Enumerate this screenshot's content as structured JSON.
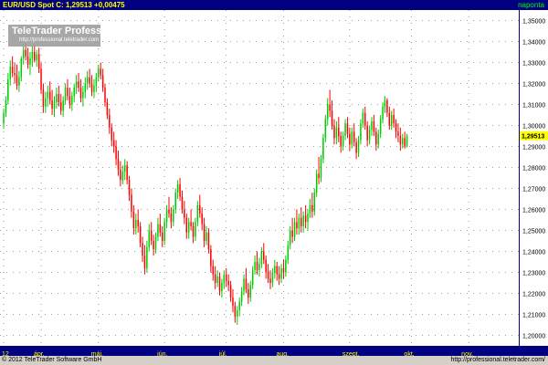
{
  "header": {
    "left_text": "EUR/USD Spot C: 1,29513 +0,00475",
    "right_text": "naponta"
  },
  "watermark": {
    "title": "TeleTrader Professional",
    "url": "http://professional.teletrader.com"
  },
  "footer": {
    "left": "© 2012 TeleTrader Software GmbH",
    "right": "http://professional.teletrader.com/"
  },
  "colors": {
    "up": "#00cc00",
    "down": "#ff0000",
    "grid": "#808080",
    "axis_bg": "#000080",
    "axis_text": "#ffff00",
    "last_price_bg": "#ffff00"
  },
  "chart_data": {
    "type": "candlestick",
    "symbol": "EUR/USD Spot",
    "frequency": "naponta",
    "last_close": 1.29513,
    "last_close_label": "1,29513",
    "change": 0.00475,
    "ylim": [
      1.195,
      1.355
    ],
    "yticks": [
      1.2,
      1.21,
      1.22,
      1.23,
      1.24,
      1.25,
      1.26,
      1.27,
      1.28,
      1.29,
      1.3,
      1.31,
      1.32,
      1.33,
      1.34,
      1.35
    ],
    "ytick_labels": [
      "1,20000",
      "1,21000",
      "1,22000",
      "1,23000",
      "1,24000",
      "1,25000",
      "1,26000",
      "1,27000",
      "1,28000",
      "1,29000",
      "1,30000",
      "1,31000",
      "1,32000",
      "1,33000",
      "1,34000",
      "1,35000"
    ],
    "xlim": [
      0,
      213
    ],
    "xticks": [
      {
        "label": "12",
        "x": 0
      },
      {
        "label": "ápr.",
        "x": 17
      },
      {
        "label": "máj.",
        "x": 43
      },
      {
        "label": "jún.",
        "x": 73
      },
      {
        "label": "júl.",
        "x": 101
      },
      {
        "label": "aug.",
        "x": 127
      },
      {
        "label": "szept.",
        "x": 157
      },
      {
        "label": "okt.",
        "x": 185
      },
      {
        "label": "nov.",
        "x": 211
      }
    ],
    "grid": true,
    "candles": [
      {
        "o": 1.301,
        "h": 1.308,
        "l": 1.2985,
        "c": 1.306
      },
      {
        "o": 1.306,
        "h": 1.314,
        "l": 1.304,
        "c": 1.312
      },
      {
        "o": 1.312,
        "h": 1.325,
        "l": 1.31,
        "c": 1.322
      },
      {
        "o": 1.322,
        "h": 1.331,
        "l": 1.319,
        "c": 1.328
      },
      {
        "o": 1.328,
        "h": 1.333,
        "l": 1.323,
        "c": 1.325
      },
      {
        "o": 1.325,
        "h": 1.33,
        "l": 1.32,
        "c": 1.324
      },
      {
        "o": 1.324,
        "h": 1.329,
        "l": 1.317,
        "c": 1.319
      },
      {
        "o": 1.319,
        "h": 1.326,
        "l": 1.316,
        "c": 1.323
      },
      {
        "o": 1.323,
        "h": 1.333,
        "l": 1.321,
        "c": 1.332
      },
      {
        "o": 1.332,
        "h": 1.339,
        "l": 1.329,
        "c": 1.336
      },
      {
        "o": 1.336,
        "h": 1.34,
        "l": 1.331,
        "c": 1.333
      },
      {
        "o": 1.333,
        "h": 1.337,
        "l": 1.327,
        "c": 1.329
      },
      {
        "o": 1.329,
        "h": 1.335,
        "l": 1.324,
        "c": 1.332
      },
      {
        "o": 1.332,
        "h": 1.338,
        "l": 1.328,
        "c": 1.335
      },
      {
        "o": 1.335,
        "h": 1.339,
        "l": 1.33,
        "c": 1.331
      },
      {
        "o": 1.331,
        "h": 1.336,
        "l": 1.328,
        "c": 1.334
      },
      {
        "o": 1.334,
        "h": 1.337,
        "l": 1.325,
        "c": 1.327
      },
      {
        "o": 1.327,
        "h": 1.33,
        "l": 1.315,
        "c": 1.317
      },
      {
        "o": 1.317,
        "h": 1.32,
        "l": 1.306,
        "c": 1.309
      },
      {
        "o": 1.309,
        "h": 1.316,
        "l": 1.306,
        "c": 1.313
      },
      {
        "o": 1.313,
        "h": 1.319,
        "l": 1.309,
        "c": 1.316
      },
      {
        "o": 1.316,
        "h": 1.321,
        "l": 1.31,
        "c": 1.312
      },
      {
        "o": 1.312,
        "h": 1.317,
        "l": 1.305,
        "c": 1.308
      },
      {
        "o": 1.308,
        "h": 1.314,
        "l": 1.304,
        "c": 1.311
      },
      {
        "o": 1.311,
        "h": 1.318,
        "l": 1.308,
        "c": 1.315
      },
      {
        "o": 1.315,
        "h": 1.319,
        "l": 1.309,
        "c": 1.311
      },
      {
        "o": 1.311,
        "h": 1.315,
        "l": 1.305,
        "c": 1.307
      },
      {
        "o": 1.307,
        "h": 1.314,
        "l": 1.304,
        "c": 1.312
      },
      {
        "o": 1.312,
        "h": 1.32,
        "l": 1.31,
        "c": 1.318
      },
      {
        "o": 1.318,
        "h": 1.322,
        "l": 1.312,
        "c": 1.314
      },
      {
        "o": 1.314,
        "h": 1.318,
        "l": 1.308,
        "c": 1.31
      },
      {
        "o": 1.31,
        "h": 1.316,
        "l": 1.307,
        "c": 1.314
      },
      {
        "o": 1.314,
        "h": 1.32,
        "l": 1.311,
        "c": 1.318
      },
      {
        "o": 1.318,
        "h": 1.324,
        "l": 1.315,
        "c": 1.321
      },
      {
        "o": 1.321,
        "h": 1.325,
        "l": 1.316,
        "c": 1.318
      },
      {
        "o": 1.318,
        "h": 1.322,
        "l": 1.311,
        "c": 1.313
      },
      {
        "o": 1.313,
        "h": 1.319,
        "l": 1.309,
        "c": 1.316
      },
      {
        "o": 1.316,
        "h": 1.323,
        "l": 1.313,
        "c": 1.32
      },
      {
        "o": 1.32,
        "h": 1.326,
        "l": 1.317,
        "c": 1.323
      },
      {
        "o": 1.323,
        "h": 1.327,
        "l": 1.318,
        "c": 1.32
      },
      {
        "o": 1.32,
        "h": 1.324,
        "l": 1.314,
        "c": 1.316
      },
      {
        "o": 1.316,
        "h": 1.322,
        "l": 1.313,
        "c": 1.319
      },
      {
        "o": 1.319,
        "h": 1.325,
        "l": 1.316,
        "c": 1.323
      },
      {
        "o": 1.323,
        "h": 1.329,
        "l": 1.321,
        "c": 1.327
      },
      {
        "o": 1.327,
        "h": 1.33,
        "l": 1.322,
        "c": 1.324
      },
      {
        "o": 1.324,
        "h": 1.327,
        "l": 1.316,
        "c": 1.318
      },
      {
        "o": 1.318,
        "h": 1.32,
        "l": 1.309,
        "c": 1.311
      },
      {
        "o": 1.311,
        "h": 1.313,
        "l": 1.303,
        "c": 1.305
      },
      {
        "o": 1.305,
        "h": 1.308,
        "l": 1.296,
        "c": 1.299
      },
      {
        "o": 1.299,
        "h": 1.301,
        "l": 1.29,
        "c": 1.293
      },
      {
        "o": 1.293,
        "h": 1.297,
        "l": 1.287,
        "c": 1.29
      },
      {
        "o": 1.29,
        "h": 1.293,
        "l": 1.281,
        "c": 1.284
      },
      {
        "o": 1.284,
        "h": 1.288,
        "l": 1.276,
        "c": 1.279
      },
      {
        "o": 1.279,
        "h": 1.283,
        "l": 1.271,
        "c": 1.274
      },
      {
        "o": 1.274,
        "h": 1.281,
        "l": 1.272,
        "c": 1.278
      },
      {
        "o": 1.278,
        "h": 1.284,
        "l": 1.274,
        "c": 1.281
      },
      {
        "o": 1.281,
        "h": 1.283,
        "l": 1.272,
        "c": 1.274
      },
      {
        "o": 1.274,
        "h": 1.276,
        "l": 1.264,
        "c": 1.267
      },
      {
        "o": 1.267,
        "h": 1.27,
        "l": 1.256,
        "c": 1.259
      },
      {
        "o": 1.259,
        "h": 1.262,
        "l": 1.248,
        "c": 1.251
      },
      {
        "o": 1.251,
        "h": 1.258,
        "l": 1.248,
        "c": 1.255
      },
      {
        "o": 1.255,
        "h": 1.26,
        "l": 1.249,
        "c": 1.252
      },
      {
        "o": 1.252,
        "h": 1.254,
        "l": 1.242,
        "c": 1.244
      },
      {
        "o": 1.244,
        "h": 1.247,
        "l": 1.235,
        "c": 1.238
      },
      {
        "o": 1.238,
        "h": 1.243,
        "l": 1.229,
        "c": 1.232
      },
      {
        "o": 1.232,
        "h": 1.245,
        "l": 1.23,
        "c": 1.242
      },
      {
        "o": 1.242,
        "h": 1.253,
        "l": 1.24,
        "c": 1.25
      },
      {
        "o": 1.25,
        "h": 1.254,
        "l": 1.243,
        "c": 1.245
      },
      {
        "o": 1.245,
        "h": 1.248,
        "l": 1.238,
        "c": 1.241
      },
      {
        "o": 1.241,
        "h": 1.249,
        "l": 1.239,
        "c": 1.247
      },
      {
        "o": 1.247,
        "h": 1.256,
        "l": 1.245,
        "c": 1.253
      },
      {
        "o": 1.253,
        "h": 1.258,
        "l": 1.247,
        "c": 1.249
      },
      {
        "o": 1.249,
        "h": 1.252,
        "l": 1.242,
        "c": 1.245
      },
      {
        "o": 1.245,
        "h": 1.256,
        "l": 1.243,
        "c": 1.254
      },
      {
        "o": 1.254,
        "h": 1.262,
        "l": 1.251,
        "c": 1.26
      },
      {
        "o": 1.26,
        "h": 1.266,
        "l": 1.256,
        "c": 1.258
      },
      {
        "o": 1.258,
        "h": 1.261,
        "l": 1.251,
        "c": 1.254
      },
      {
        "o": 1.254,
        "h": 1.262,
        "l": 1.252,
        "c": 1.26
      },
      {
        "o": 1.26,
        "h": 1.27,
        "l": 1.258,
        "c": 1.268
      },
      {
        "o": 1.268,
        "h": 1.274,
        "l": 1.265,
        "c": 1.272
      },
      {
        "o": 1.272,
        "h": 1.275,
        "l": 1.264,
        "c": 1.266
      },
      {
        "o": 1.266,
        "h": 1.269,
        "l": 1.258,
        "c": 1.26
      },
      {
        "o": 1.26,
        "h": 1.264,
        "l": 1.253,
        "c": 1.256
      },
      {
        "o": 1.256,
        "h": 1.258,
        "l": 1.246,
        "c": 1.249
      },
      {
        "o": 1.249,
        "h": 1.256,
        "l": 1.246,
        "c": 1.254
      },
      {
        "o": 1.254,
        "h": 1.26,
        "l": 1.25,
        "c": 1.252
      },
      {
        "o": 1.252,
        "h": 1.254,
        "l": 1.244,
        "c": 1.247
      },
      {
        "o": 1.247,
        "h": 1.256,
        "l": 1.245,
        "c": 1.254
      },
      {
        "o": 1.254,
        "h": 1.264,
        "l": 1.252,
        "c": 1.262
      },
      {
        "o": 1.262,
        "h": 1.267,
        "l": 1.256,
        "c": 1.258
      },
      {
        "o": 1.258,
        "h": 1.261,
        "l": 1.25,
        "c": 1.253
      },
      {
        "o": 1.253,
        "h": 1.256,
        "l": 1.242,
        "c": 1.245
      },
      {
        "o": 1.245,
        "h": 1.252,
        "l": 1.243,
        "c": 1.249
      },
      {
        "o": 1.249,
        "h": 1.251,
        "l": 1.239,
        "c": 1.241
      },
      {
        "o": 1.241,
        "h": 1.243,
        "l": 1.23,
        "c": 1.233
      },
      {
        "o": 1.233,
        "h": 1.236,
        "l": 1.226,
        "c": 1.229
      },
      {
        "o": 1.229,
        "h": 1.233,
        "l": 1.222,
        "c": 1.225
      },
      {
        "o": 1.225,
        "h": 1.231,
        "l": 1.223,
        "c": 1.228
      },
      {
        "o": 1.228,
        "h": 1.23,
        "l": 1.219,
        "c": 1.221
      },
      {
        "o": 1.221,
        "h": 1.227,
        "l": 1.218,
        "c": 1.225
      },
      {
        "o": 1.225,
        "h": 1.231,
        "l": 1.222,
        "c": 1.229
      },
      {
        "o": 1.229,
        "h": 1.232,
        "l": 1.223,
        "c": 1.226
      },
      {
        "o": 1.226,
        "h": 1.229,
        "l": 1.221,
        "c": 1.224
      },
      {
        "o": 1.224,
        "h": 1.226,
        "l": 1.216,
        "c": 1.218
      },
      {
        "o": 1.218,
        "h": 1.222,
        "l": 1.211,
        "c": 1.214
      },
      {
        "o": 1.214,
        "h": 1.216,
        "l": 1.206,
        "c": 1.209
      },
      {
        "o": 1.209,
        "h": 1.214,
        "l": 1.205,
        "c": 1.212
      },
      {
        "o": 1.212,
        "h": 1.218,
        "l": 1.209,
        "c": 1.216
      },
      {
        "o": 1.216,
        "h": 1.223,
        "l": 1.214,
        "c": 1.221
      },
      {
        "o": 1.221,
        "h": 1.229,
        "l": 1.219,
        "c": 1.227
      },
      {
        "o": 1.227,
        "h": 1.232,
        "l": 1.22,
        "c": 1.222
      },
      {
        "o": 1.222,
        "h": 1.225,
        "l": 1.215,
        "c": 1.218
      },
      {
        "o": 1.218,
        "h": 1.226,
        "l": 1.216,
        "c": 1.224
      },
      {
        "o": 1.224,
        "h": 1.233,
        "l": 1.222,
        "c": 1.231
      },
      {
        "o": 1.231,
        "h": 1.238,
        "l": 1.229,
        "c": 1.235
      },
      {
        "o": 1.235,
        "h": 1.24,
        "l": 1.229,
        "c": 1.231
      },
      {
        "o": 1.231,
        "h": 1.237,
        "l": 1.228,
        "c": 1.234
      },
      {
        "o": 1.234,
        "h": 1.242,
        "l": 1.232,
        "c": 1.24
      },
      {
        "o": 1.24,
        "h": 1.244,
        "l": 1.234,
        "c": 1.236
      },
      {
        "o": 1.236,
        "h": 1.238,
        "l": 1.227,
        "c": 1.23
      },
      {
        "o": 1.23,
        "h": 1.234,
        "l": 1.225,
        "c": 1.227
      },
      {
        "o": 1.227,
        "h": 1.231,
        "l": 1.222,
        "c": 1.225
      },
      {
        "o": 1.225,
        "h": 1.232,
        "l": 1.223,
        "c": 1.23
      },
      {
        "o": 1.23,
        "h": 1.236,
        "l": 1.227,
        "c": 1.233
      },
      {
        "o": 1.233,
        "h": 1.235,
        "l": 1.226,
        "c": 1.229
      },
      {
        "o": 1.229,
        "h": 1.233,
        "l": 1.224,
        "c": 1.227
      },
      {
        "o": 1.227,
        "h": 1.234,
        "l": 1.225,
        "c": 1.232
      },
      {
        "o": 1.232,
        "h": 1.236,
        "l": 1.227,
        "c": 1.23
      },
      {
        "o": 1.23,
        "h": 1.238,
        "l": 1.228,
        "c": 1.236
      },
      {
        "o": 1.236,
        "h": 1.245,
        "l": 1.234,
        "c": 1.243
      },
      {
        "o": 1.243,
        "h": 1.252,
        "l": 1.241,
        "c": 1.25
      },
      {
        "o": 1.25,
        "h": 1.256,
        "l": 1.244,
        "c": 1.247
      },
      {
        "o": 1.247,
        "h": 1.256,
        "l": 1.245,
        "c": 1.254
      },
      {
        "o": 1.254,
        "h": 1.26,
        "l": 1.248,
        "c": 1.251
      },
      {
        "o": 1.251,
        "h": 1.258,
        "l": 1.248,
        "c": 1.256
      },
      {
        "o": 1.256,
        "h": 1.261,
        "l": 1.249,
        "c": 1.252
      },
      {
        "o": 1.252,
        "h": 1.259,
        "l": 1.249,
        "c": 1.257
      },
      {
        "o": 1.257,
        "h": 1.262,
        "l": 1.251,
        "c": 1.254
      },
      {
        "o": 1.254,
        "h": 1.26,
        "l": 1.25,
        "c": 1.258
      },
      {
        "o": 1.258,
        "h": 1.265,
        "l": 1.256,
        "c": 1.262
      },
      {
        "o": 1.262,
        "h": 1.268,
        "l": 1.256,
        "c": 1.259
      },
      {
        "o": 1.259,
        "h": 1.27,
        "l": 1.257,
        "c": 1.268
      },
      {
        "o": 1.268,
        "h": 1.279,
        "l": 1.266,
        "c": 1.277
      },
      {
        "o": 1.277,
        "h": 1.285,
        "l": 1.272,
        "c": 1.275
      },
      {
        "o": 1.275,
        "h": 1.286,
        "l": 1.273,
        "c": 1.284
      },
      {
        "o": 1.284,
        "h": 1.296,
        "l": 1.282,
        "c": 1.294
      },
      {
        "o": 1.294,
        "h": 1.305,
        "l": 1.292,
        "c": 1.303
      },
      {
        "o": 1.303,
        "h": 1.313,
        "l": 1.3,
        "c": 1.31
      },
      {
        "o": 1.31,
        "h": 1.317,
        "l": 1.304,
        "c": 1.307
      },
      {
        "o": 1.307,
        "h": 1.312,
        "l": 1.298,
        "c": 1.3
      },
      {
        "o": 1.3,
        "h": 1.303,
        "l": 1.291,
        "c": 1.294
      },
      {
        "o": 1.294,
        "h": 1.302,
        "l": 1.291,
        "c": 1.299
      },
      {
        "o": 1.299,
        "h": 1.304,
        "l": 1.292,
        "c": 1.295
      },
      {
        "o": 1.295,
        "h": 1.297,
        "l": 1.287,
        "c": 1.29
      },
      {
        "o": 1.29,
        "h": 1.297,
        "l": 1.288,
        "c": 1.295
      },
      {
        "o": 1.295,
        "h": 1.303,
        "l": 1.293,
        "c": 1.301
      },
      {
        "o": 1.301,
        "h": 1.304,
        "l": 1.294,
        "c": 1.296
      },
      {
        "o": 1.296,
        "h": 1.299,
        "l": 1.288,
        "c": 1.291
      },
      {
        "o": 1.291,
        "h": 1.299,
        "l": 1.289,
        "c": 1.297
      },
      {
        "o": 1.297,
        "h": 1.301,
        "l": 1.29,
        "c": 1.292
      },
      {
        "o": 1.292,
        "h": 1.294,
        "l": 1.284,
        "c": 1.287
      },
      {
        "o": 1.287,
        "h": 1.295,
        "l": 1.285,
        "c": 1.293
      },
      {
        "o": 1.293,
        "h": 1.303,
        "l": 1.291,
        "c": 1.301
      },
      {
        "o": 1.301,
        "h": 1.308,
        "l": 1.299,
        "c": 1.306
      },
      {
        "o": 1.306,
        "h": 1.309,
        "l": 1.298,
        "c": 1.3
      },
      {
        "o": 1.3,
        "h": 1.302,
        "l": 1.29,
        "c": 1.293
      },
      {
        "o": 1.293,
        "h": 1.3,
        "l": 1.291,
        "c": 1.298
      },
      {
        "o": 1.298,
        "h": 1.304,
        "l": 1.295,
        "c": 1.302
      },
      {
        "o": 1.302,
        "h": 1.305,
        "l": 1.295,
        "c": 1.297
      },
      {
        "o": 1.297,
        "h": 1.299,
        "l": 1.288,
        "c": 1.291
      },
      {
        "o": 1.291,
        "h": 1.298,
        "l": 1.289,
        "c": 1.296
      },
      {
        "o": 1.296,
        "h": 1.305,
        "l": 1.294,
        "c": 1.303
      },
      {
        "o": 1.303,
        "h": 1.311,
        "l": 1.301,
        "c": 1.309
      },
      {
        "o": 1.309,
        "h": 1.314,
        "l": 1.306,
        "c": 1.312
      },
      {
        "o": 1.312,
        "h": 1.313,
        "l": 1.304,
        "c": 1.306
      },
      {
        "o": 1.306,
        "h": 1.309,
        "l": 1.298,
        "c": 1.3
      },
      {
        "o": 1.3,
        "h": 1.307,
        "l": 1.298,
        "c": 1.305
      },
      {
        "o": 1.305,
        "h": 1.308,
        "l": 1.299,
        "c": 1.301
      },
      {
        "o": 1.301,
        "h": 1.303,
        "l": 1.294,
        "c": 1.297
      },
      {
        "o": 1.297,
        "h": 1.301,
        "l": 1.292,
        "c": 1.295
      },
      {
        "o": 1.295,
        "h": 1.299,
        "l": 1.288,
        "c": 1.291
      },
      {
        "o": 1.291,
        "h": 1.296,
        "l": 1.289,
        "c": 1.294
      },
      {
        "o": 1.294,
        "h": 1.297,
        "l": 1.289,
        "c": 1.29
      },
      {
        "o": 1.2904,
        "h": 1.296,
        "l": 1.2895,
        "c": 1.2951
      }
    ]
  }
}
